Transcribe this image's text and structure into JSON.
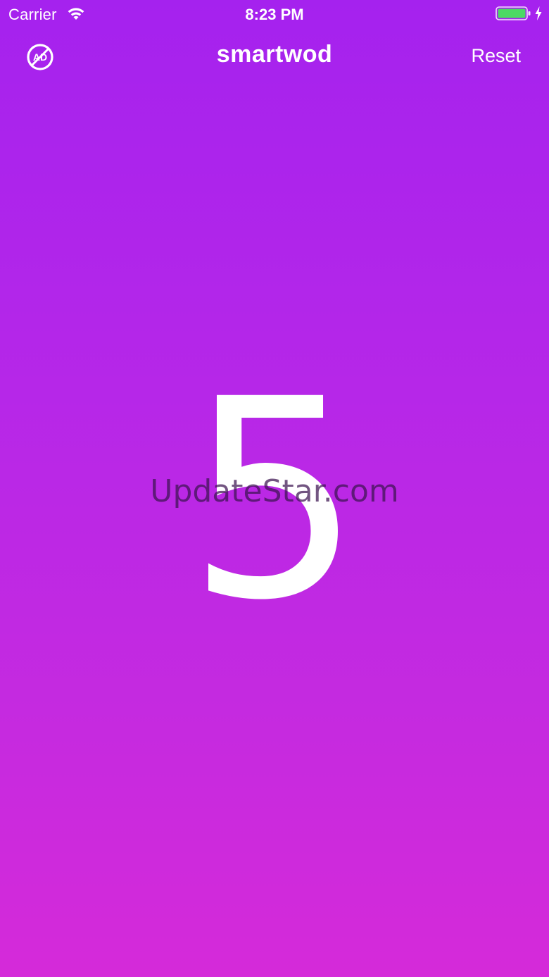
{
  "status_bar": {
    "carrier": "Carrier",
    "time": "8:23 PM",
    "icons": [
      "wifi-icon",
      "battery-icon",
      "charging-icon"
    ],
    "battery_color": "#4cd964"
  },
  "nav": {
    "no_ads_icon": "no-ads-icon",
    "no_ads_text": "AD",
    "title": "smartwod",
    "reset_label": "Reset"
  },
  "counter": {
    "value": "5"
  },
  "watermark": {
    "text": "UpdateStar.com"
  },
  "colors": {
    "gradient_top": "#a522ee",
    "gradient_bottom": "#d52ad9",
    "text": "#ffffff"
  }
}
